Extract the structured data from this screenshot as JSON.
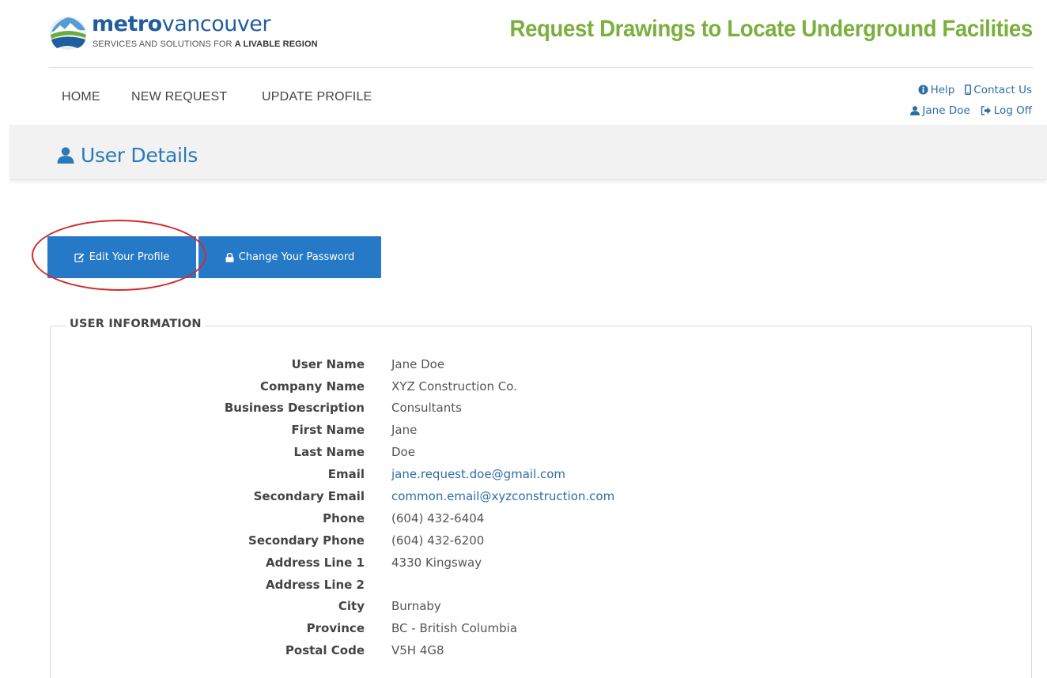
{
  "brand": {
    "wordmark_bold": "metro",
    "wordmark_light": "vancouver",
    "tagline_prefix": "SERVICES AND SOLUTIONS FOR ",
    "tagline_bold": "A LIVABLE REGION",
    "site_title": "Request Drawings to Locate Underground Facilities",
    "title_color": "#7ab03d",
    "brand_blue": "#1f5d9c"
  },
  "nav": {
    "items": [
      {
        "label": "HOME"
      },
      {
        "label": "NEW REQUEST"
      },
      {
        "label": "UPDATE PROFILE"
      }
    ]
  },
  "utility": {
    "help_label": "Help",
    "help_icon": "info-circle-icon",
    "contact_label": "Contact Us",
    "contact_icon": "mobile-phone-icon",
    "user_label": "Jane Doe",
    "user_icon": "user-icon",
    "logoff_label": "Log Off",
    "logoff_icon": "sign-out-icon"
  },
  "page": {
    "title": "User Details",
    "title_icon": "user-icon"
  },
  "actions": {
    "edit_label": "Edit Your Profile",
    "edit_icon": "edit-icon",
    "password_label": "Change Your Password",
    "password_icon": "lock-icon",
    "button_color": "#2579c7",
    "highlight_color": "#d42a2a"
  },
  "user_info": {
    "legend": "USER INFORMATION",
    "fields": [
      {
        "label": "User Name",
        "value": "Jane Doe"
      },
      {
        "label": "Company Name",
        "value": "XYZ Construction Co."
      },
      {
        "label": "Business Description",
        "value": "Consultants"
      },
      {
        "label": "First Name",
        "value": "Jane"
      },
      {
        "label": "Last Name",
        "value": "Doe"
      },
      {
        "label": "Email",
        "value": "jane.request.doe@gmail.com"
      },
      {
        "label": "Secondary Email",
        "value": "common.email@xyzconstruction.com"
      },
      {
        "label": "Phone",
        "value": "(604) 432-6404"
      },
      {
        "label": "Secondary Phone",
        "value": "(604) 432-6200"
      },
      {
        "label": "Address Line 1",
        "value": "4330 Kingsway"
      },
      {
        "label": "Address Line 2",
        "value": ""
      },
      {
        "label": "City",
        "value": "Burnaby"
      },
      {
        "label": "Province",
        "value": "BC - British Columbia"
      },
      {
        "label": "Postal Code",
        "value": "V5H 4G8"
      }
    ]
  }
}
